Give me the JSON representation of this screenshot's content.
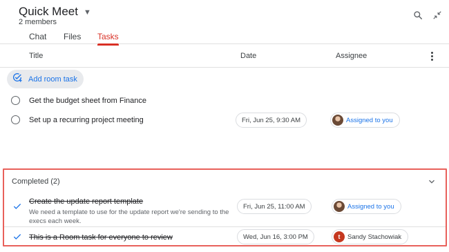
{
  "header": {
    "room_name": "Quick Meet",
    "members": "2 members",
    "tabs": [
      {
        "label": "Chat",
        "active": false
      },
      {
        "label": "Files",
        "active": false
      },
      {
        "label": "Tasks",
        "active": true
      }
    ],
    "icons": [
      "search-icon",
      "collapse-icon"
    ]
  },
  "columns": {
    "title": "Title",
    "date": "Date",
    "assignee": "Assignee"
  },
  "add_task": {
    "label": "Add room task",
    "icon": "add-task-icon"
  },
  "open_tasks": [
    {
      "title": "Get the budget sheet from Finance",
      "date": "",
      "assignee": ""
    },
    {
      "title": "Set up a recurring project meeting",
      "date": "Fri, Jun 25, 9:30 AM",
      "assignee": "Assigned to you"
    }
  ],
  "completed": {
    "label": "Completed (2)",
    "tasks": [
      {
        "title": "Create the update report template",
        "description": "We need a template to use for the update report we're sending to the execs each week.",
        "date": "Fri, Jun 25, 11:00 AM",
        "assignee": "Assigned to you"
      },
      {
        "title": "This is a Room task for everyone to review",
        "description": "",
        "date": "Wed, Jun 16, 3:00 PM",
        "assignee": "Sandy Stachowiak",
        "avatar_letter": "t"
      }
    ]
  },
  "colors": {
    "accent": "#1a73e8",
    "tab_active": "#d93025",
    "highlight_border": "#e8605a"
  }
}
